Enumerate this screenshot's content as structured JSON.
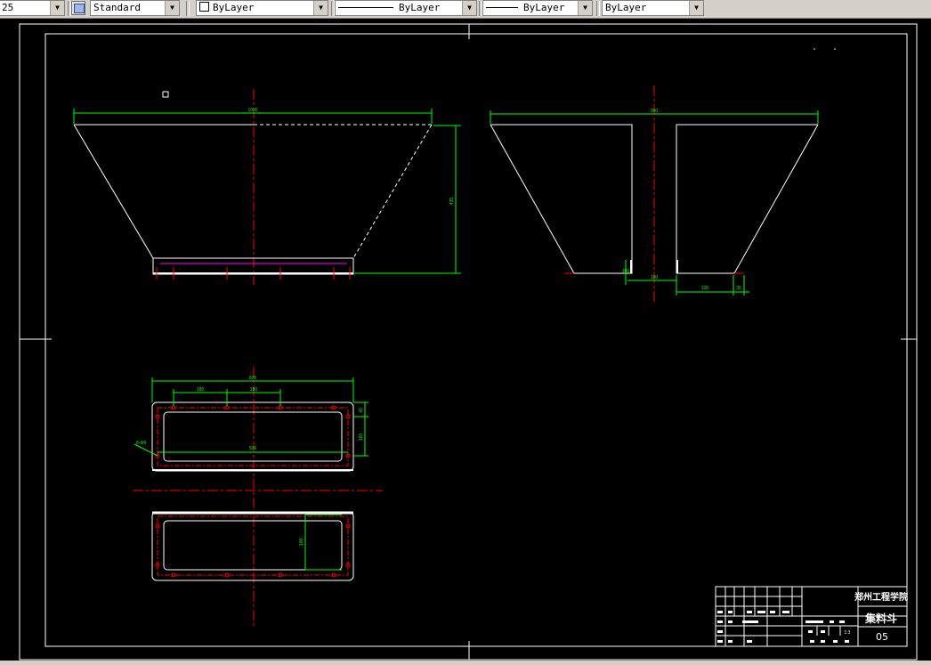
{
  "toolbar": {
    "scale_value": "25",
    "textstyle_value": "Standard",
    "layer_value": "ByLayer",
    "linetype_value": "ByLayer",
    "lineweight_value": "ByLayer",
    "plotstyle_value": "ByLayer",
    "icons": {
      "dropdown": "chevron-down-icon",
      "textstyle": "text-style-icon",
      "layer_swatch": "color-swatch-icon"
    }
  },
  "drawing": {
    "colors": {
      "background": "#000000",
      "outline": "#ffffff",
      "dimension": "#00ff00",
      "centerline": "#ff0000",
      "hidden": "#ff00ff"
    },
    "front_view": {
      "width_dim": "1000",
      "height_dim": "435"
    },
    "side_view": {
      "width_dim": "900",
      "bottom_dim_1": "100",
      "bottom_dim_2": "100",
      "bottom_dim_3": "35"
    },
    "top_view": {
      "overall_dim": "600",
      "spacing_dim_1": "180",
      "spacing_dim_2": "180",
      "inner_dim": "506",
      "side_dim_1": "40",
      "side_dim_2": "160",
      "hole_note": "8-Φ8"
    },
    "bottom_view": {
      "height_dim": "100"
    },
    "title_block": {
      "school": "郑州工程学院",
      "drawing_title": "集料斗",
      "drawing_number": "05",
      "scale": "1:3"
    }
  }
}
